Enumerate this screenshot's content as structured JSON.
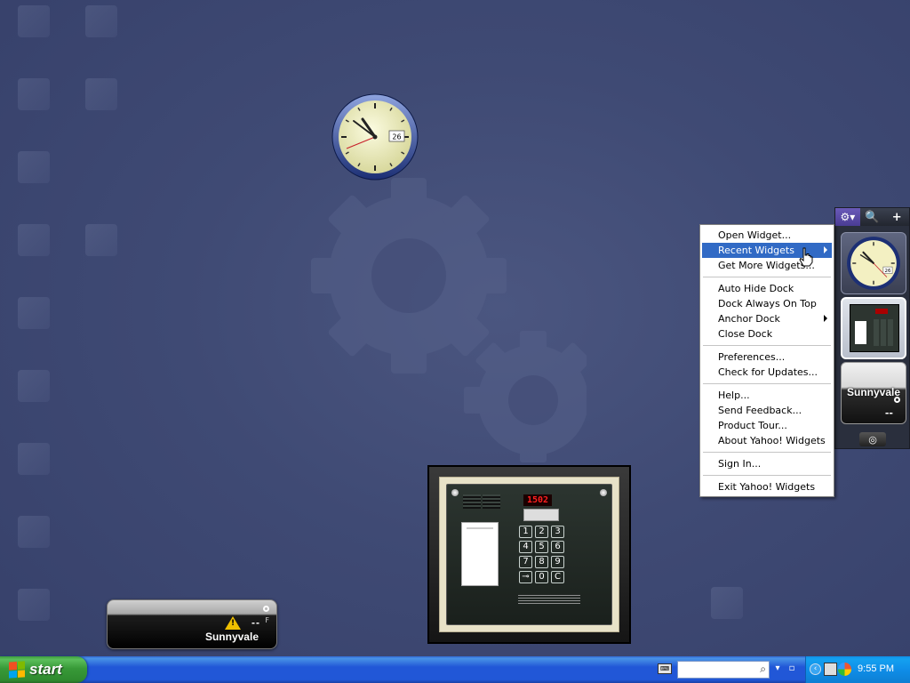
{
  "clock": {
    "date": "26"
  },
  "dock": {
    "gear_label": "⚙▾",
    "search_label": "🔍",
    "add_label": "+",
    "clock_date": "26",
    "weather_city": "Sunnyvale",
    "weather_temp": "--",
    "camera_label": "◎"
  },
  "menu": {
    "groups": [
      [
        "Open Widget...",
        "Recent Widgets",
        "Get More Widgets..."
      ],
      [
        "Auto Hide Dock",
        "Dock Always On Top",
        "Anchor Dock",
        "Close Dock"
      ],
      [
        "Preferences...",
        "Check for Updates..."
      ],
      [
        "Help...",
        "Send Feedback...",
        "Product Tour...",
        "About Yahoo! Widgets"
      ],
      [
        "Sign In..."
      ],
      [
        "Exit Yahoo! Widgets"
      ]
    ],
    "highlighted": "Recent Widgets"
  },
  "keypad": {
    "display": "1502",
    "keys": [
      "1",
      "2",
      "3",
      "4",
      "5",
      "6",
      "7",
      "8",
      "9",
      "⊸",
      "0",
      "C"
    ]
  },
  "weather": {
    "city": "Sunnyvale",
    "temp": "--",
    "unit": "F",
    "warning_glyph": "!"
  },
  "taskbar": {
    "start_label": "start",
    "keyboard_icon": "⌨",
    "search_placeholder": "",
    "time": "9:55 PM"
  },
  "colors": {
    "desktop": "#3f4a74",
    "taskbar": "#2157d7",
    "start_button": "#389a38",
    "menu_highlight": "#316ac5",
    "tray": "#0f8ee8"
  }
}
